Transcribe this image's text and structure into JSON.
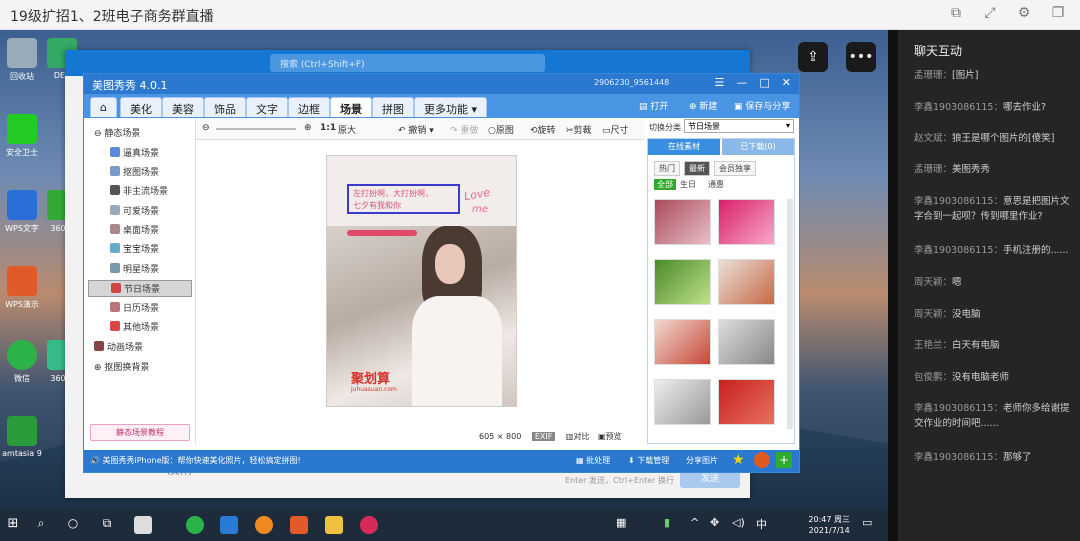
{
  "stream": {
    "title": "19级扩招1、2班电子商务群直播"
  },
  "desktop_icons": [
    {
      "label": "回收站"
    },
    {
      "label": "DEE"
    },
    {
      "label": "安全卫士"
    },
    {
      "label": "WPS文字"
    },
    {
      "label": "360安"
    },
    {
      "label": "WPS演示"
    },
    {
      "label": "微信"
    },
    {
      "label": "360软"
    },
    {
      "label": "amtasia 9"
    }
  ],
  "bg_window": {
    "search_placeholder": "搜索 (Ctrl+Shift+F)",
    "partial_text": "(文件)",
    "input_hint": "Enter 发送，Ctrl+Enter 换行",
    "send_label": "发送"
  },
  "app": {
    "title": "美图秀秀 4.0.1",
    "account": "2906230_9561448",
    "tabs": [
      "美化",
      "美容",
      "饰品",
      "文字",
      "边框",
      "场景",
      "拼图",
      "更多功能"
    ],
    "active_tab": "场景",
    "actions": {
      "open": "打开",
      "new": "新建",
      "save": "保存与分享"
    },
    "tools": {
      "zoom_ratio": "1:1",
      "original": "原大",
      "undo": "撤销",
      "redo": "重做",
      "crop_view": "原图",
      "rotate": "旋转",
      "cut": "剪裁",
      "size": "尺寸"
    },
    "category_label": "切换分类",
    "category_value": "节日场景",
    "tree": [
      "静态场景",
      "逼真场景",
      "抠图场景",
      "非主流场景",
      "可爱场景",
      "桌面场景",
      "宝宝场景",
      "明星场景",
      "节日场景",
      "日历场景",
      "其他场景",
      "动画场景",
      "抠图换背景"
    ],
    "tutorial": "静态场景教程",
    "canvas": {
      "text_line1": "左打扮啊，大打扮啊，",
      "text_line2": "七夕有我和你",
      "love": "Love",
      "me": "me",
      "brand": "聚划算",
      "brand_sub": "juhuasuan.com",
      "size": "605 × 800",
      "exif": "EXIF",
      "compare": "对比",
      "preview": "预览"
    },
    "material": {
      "tab_online": "在线素材",
      "tab_downloaded": "已下载(0)",
      "filters": [
        "热门",
        "最新",
        "会员独享"
      ],
      "sub": [
        "全部",
        "生日",
        "通惠"
      ]
    },
    "status": {
      "left": "美图秀秀iPhone版：帮你快速美化照片，轻松搞定拼图!",
      "batch": "批处理",
      "downloads": "下载管理",
      "share": "分享图片"
    }
  },
  "taskbar": {
    "time": "20:47 周三",
    "date": "2021/7/14"
  },
  "chat": {
    "header": "聊天互动",
    "messages": [
      {
        "user": "孟珊珊：",
        "text": "[图片]"
      },
      {
        "user": "李鑫1903086115：",
        "text": "哪去作业?"
      },
      {
        "user": "赵文斌：",
        "text": "狼王是哪个图片的[傻笑]"
      },
      {
        "user": "孟珊珊：",
        "text": "美图秀秀"
      },
      {
        "user": "李鑫1903086115：",
        "text": "意思是把图片文字合到一起呗？传到哪里作业?"
      },
      {
        "user": "李鑫1903086115：",
        "text": "手机注册的......"
      },
      {
        "user": "周天颖：",
        "text": "嗯"
      },
      {
        "user": "周天颖：",
        "text": "没电脑"
      },
      {
        "user": "王艳兰：",
        "text": "白天有电脑"
      },
      {
        "user": "包俊鹏：",
        "text": "没有电脑老师"
      },
      {
        "user": "李鑫1903086115：",
        "text": "老师你多给谢提交作业的时间吧......"
      },
      {
        "user": "李鑫1903086115：",
        "text": "那够了"
      }
    ]
  }
}
